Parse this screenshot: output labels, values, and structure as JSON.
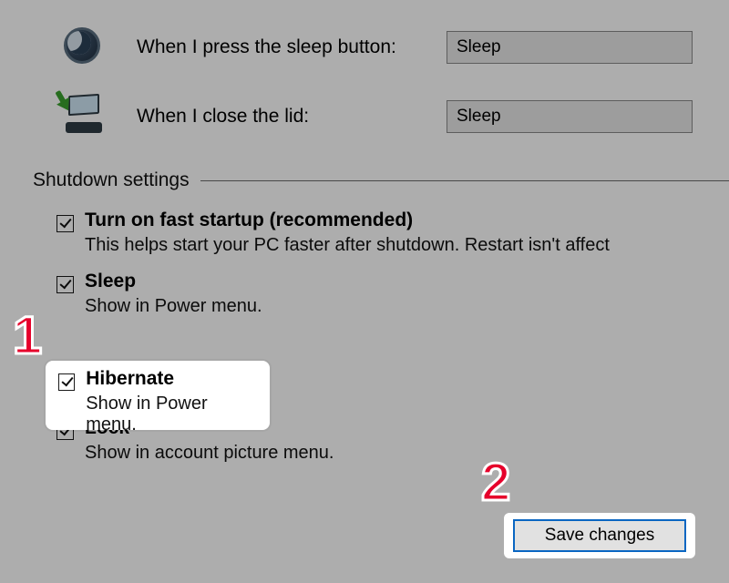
{
  "power_buttons": {
    "sleep_button": {
      "label": "When I press the sleep button:",
      "value": "Sleep"
    },
    "close_lid": {
      "label": "When I close the lid:",
      "value": "Sleep"
    }
  },
  "shutdown": {
    "group_title": "Shutdown settings",
    "options": {
      "fast_startup": {
        "title": "Turn on fast startup (recommended)",
        "desc": "This helps start your PC faster after shutdown. Restart isn't affect"
      },
      "sleep": {
        "title": "Sleep",
        "desc": "Show in Power menu."
      },
      "hibernate": {
        "title": "Hibernate",
        "desc": "Show in Power menu."
      },
      "lock": {
        "title": "Lock",
        "desc": "Show in account picture menu."
      }
    }
  },
  "buttons": {
    "save": "Save changes"
  },
  "annotations": {
    "step1": "1",
    "step2": "2"
  }
}
